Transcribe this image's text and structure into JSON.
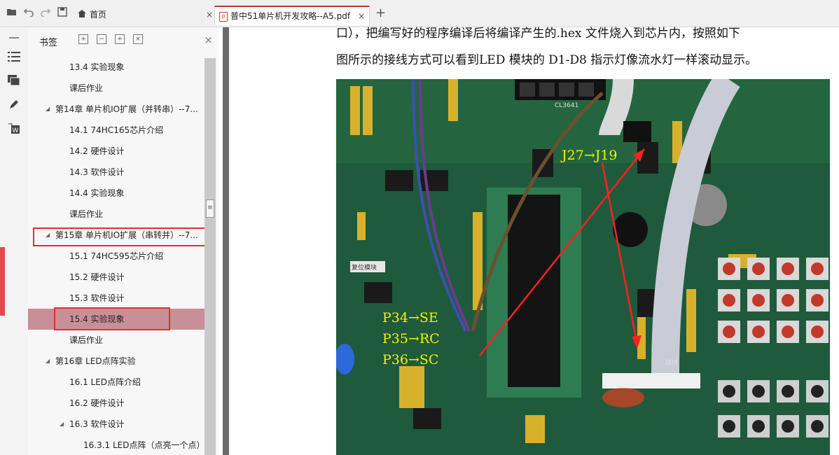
{
  "toolbar": {
    "open_icon": "folder-open-icon",
    "undo_icon": "undo-icon",
    "redo_icon": "redo-icon",
    "save_icon": "save-icon"
  },
  "tabs": [
    {
      "label": "首页",
      "icon": "home-icon"
    },
    {
      "label": "普中51单片机开发攻略--A5.pdf",
      "icon": "pdf-icon"
    }
  ],
  "new_tab_label": "+",
  "close_label": "×",
  "bookmark_panel": {
    "title": "书签",
    "items": [
      {
        "label": "13.4 实验现象",
        "level": 2
      },
      {
        "label": "课后作业",
        "level": 2
      },
      {
        "label": "第14章 单片机IO扩展（并转串）--7...",
        "level": 1,
        "expanded": true
      },
      {
        "label": "14.1 74HC165芯片介绍",
        "level": 2
      },
      {
        "label": "14.2 硬件设计",
        "level": 2
      },
      {
        "label": "14.3 软件设计",
        "level": 2
      },
      {
        "label": "14.4 实验现象",
        "level": 2
      },
      {
        "label": "课后作业",
        "level": 2
      },
      {
        "label": "第15章 单片机IO扩展（串转并）--7...",
        "level": 1,
        "expanded": true
      },
      {
        "label": "15.1 74HC595芯片介绍",
        "level": 2
      },
      {
        "label": "15.2 硬件设计",
        "level": 2
      },
      {
        "label": "15.3 软件设计",
        "level": 2
      },
      {
        "label": "15.4 实验现象",
        "level": 2,
        "selected": true
      },
      {
        "label": "课后作业",
        "level": 2
      },
      {
        "label": "第16章 LED点阵实验",
        "level": 1,
        "expanded": true
      },
      {
        "label": "16.1 LED点阵介绍",
        "level": 2
      },
      {
        "label": "16.2 硬件设计",
        "level": 2
      },
      {
        "label": "16.3 软件设计",
        "level": 2,
        "expanded": true
      },
      {
        "label": "16.3.1 LED点阵（点亮一个点）",
        "level": 3
      }
    ]
  },
  "document": {
    "lines": [
      "口），把编写好的程序编译后将编译产生的.hex 文件烧入到芯片内，按照如下",
      "图所示的接线方式可以看到LED 模块的 D1-D8 指示灯像流水灯一样滚动显示。"
    ],
    "photo_labels": {
      "j27": "J27→J19",
      "p34": "P34→SE",
      "p35": "P35→RC",
      "p36": "P36→SC",
      "reset": "复位模块",
      "chip": "CL3641",
      "led_module": "模块"
    },
    "colors": {
      "board": "#1f5a3c",
      "annotation": "#f5f200",
      "arrow": "#ff2020"
    }
  }
}
